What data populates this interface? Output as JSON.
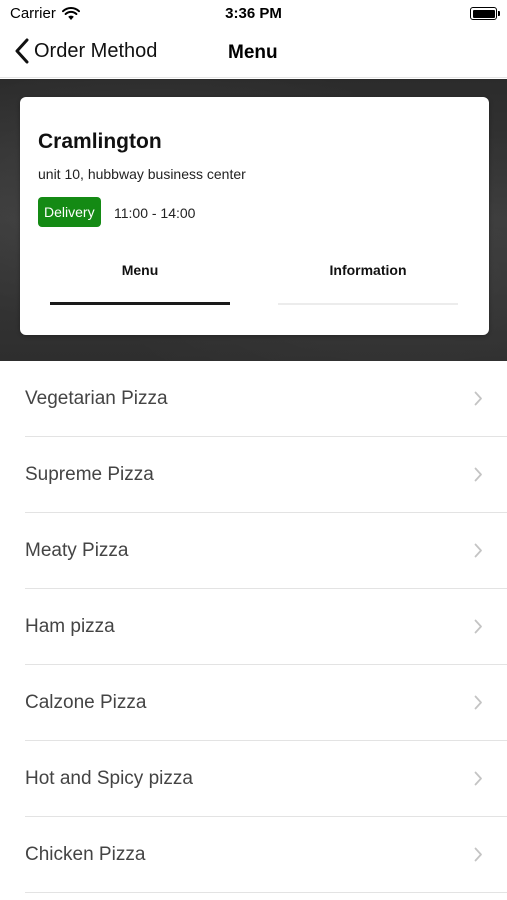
{
  "status_bar": {
    "carrier": "Carrier",
    "time": "3:36 PM"
  },
  "nav": {
    "back_label": "Order Method",
    "title": "Menu"
  },
  "store": {
    "name": "Cramlington",
    "address": "unit 10, hubbway business center",
    "badge": "Delivery",
    "hours": "11:00 - 14:00",
    "badge_color": "#148a14"
  },
  "tabs": [
    {
      "label": "Menu",
      "active": true
    },
    {
      "label": "Information",
      "active": false
    }
  ],
  "menu_items": [
    {
      "label": "Vegetarian Pizza"
    },
    {
      "label": "Supreme Pizza"
    },
    {
      "label": "Meaty Pizza"
    },
    {
      "label": "Ham pizza"
    },
    {
      "label": "Calzone Pizza"
    },
    {
      "label": "Hot and Spicy pizza"
    },
    {
      "label": "Chicken Pizza"
    }
  ]
}
